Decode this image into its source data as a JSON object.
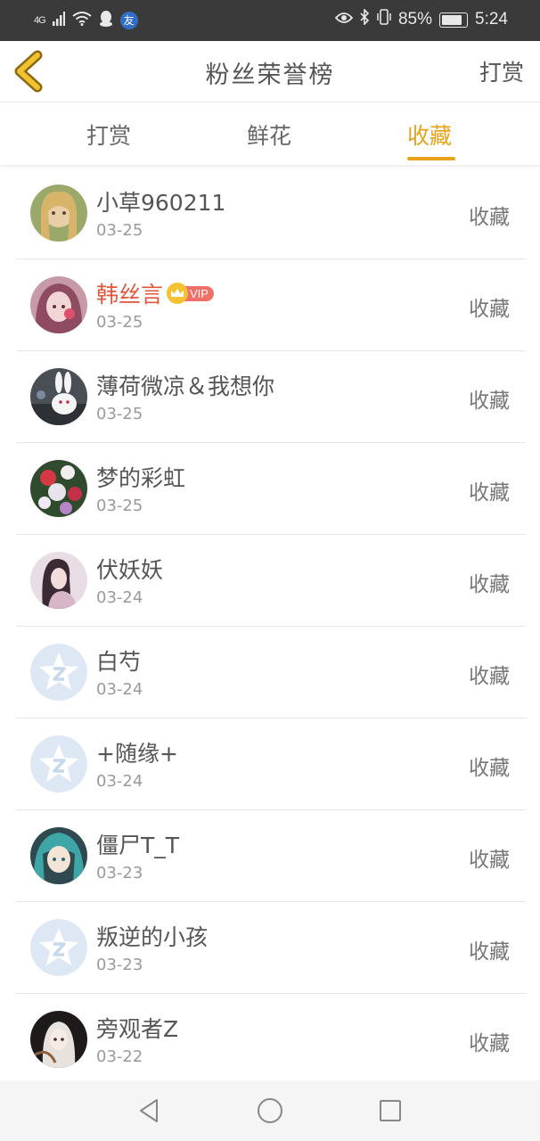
{
  "status_bar": {
    "network": "4G",
    "friend_badge": "友",
    "battery": "85%",
    "time": "5:24"
  },
  "header": {
    "title": "粉丝荣誉榜",
    "action_label": "打赏"
  },
  "tabs": [
    {
      "label": "打赏",
      "active": false
    },
    {
      "label": "鲜花",
      "active": false
    },
    {
      "label": "收藏",
      "active": true
    }
  ],
  "vip_label": "VIP",
  "colors": {
    "accent": "#e8a21a",
    "vip_name": "#e2573c"
  },
  "fans": [
    {
      "name": "小草960211",
      "date": "03-25",
      "action": "收藏",
      "avatar": "photo-doll",
      "vip": false
    },
    {
      "name": "韩丝言",
      "date": "03-25",
      "action": "收藏",
      "avatar": "photo-anime-girl",
      "vip": true
    },
    {
      "name": "薄荷微凉＆我想你",
      "date": "03-25",
      "action": "收藏",
      "avatar": "photo-bunny",
      "vip": false
    },
    {
      "name": "梦的彩虹",
      "date": "03-25",
      "action": "收藏",
      "avatar": "photo-flowers",
      "vip": false
    },
    {
      "name": "伏妖妖",
      "date": "03-24",
      "action": "收藏",
      "avatar": "photo-girl",
      "vip": false
    },
    {
      "name": "白芍",
      "date": "03-24",
      "action": "收藏",
      "avatar": "default-avatar-icon",
      "vip": false
    },
    {
      "name": "+随缘+",
      "date": "03-24",
      "action": "收藏",
      "avatar": "default-avatar-icon",
      "vip": false
    },
    {
      "name": "僵尸T_T",
      "date": "03-23",
      "action": "收藏",
      "avatar": "photo-anime-teal",
      "vip": false
    },
    {
      "name": "叛逆的小孩",
      "date": "03-23",
      "action": "收藏",
      "avatar": "default-avatar-icon",
      "vip": false
    },
    {
      "name": "旁观者Z",
      "date": "03-22",
      "action": "收藏",
      "avatar": "photo-dark-anime",
      "vip": false
    }
  ]
}
